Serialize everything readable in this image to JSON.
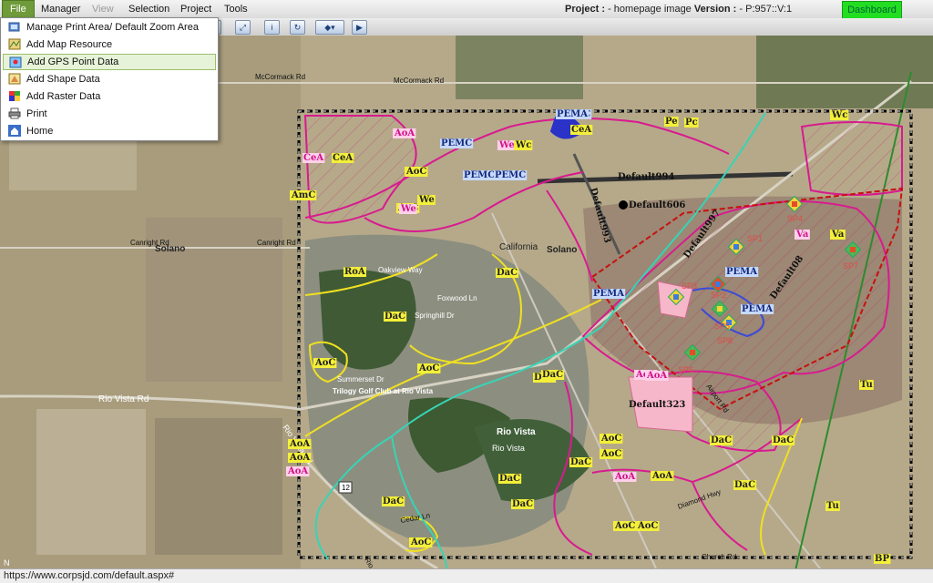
{
  "menu": {
    "items": [
      {
        "label": "File",
        "state": "active"
      },
      {
        "label": "Manager",
        "state": "normal"
      },
      {
        "label": "View",
        "state": "disabled"
      },
      {
        "label": "Selection",
        "state": "normal"
      },
      {
        "label": "Project",
        "state": "normal"
      },
      {
        "label": "Tools",
        "state": "normal"
      }
    ]
  },
  "project_info": {
    "project_label": "Project :",
    "project_value": "- homepage image",
    "version_label": "Version :",
    "version_value": "- P:957::V:1"
  },
  "dashboard_label": "Dashboard",
  "toolbar": {
    "buttons": [
      {
        "icon": "hand-pan-icon"
      },
      {
        "icon": "zoom-in-icon"
      },
      {
        "icon": "zoom-out-icon"
      },
      {
        "icon": "full-extent-icon"
      },
      {
        "icon": "identify-icon"
      },
      {
        "icon": "refresh-icon"
      },
      {
        "icon": "layers-icon"
      },
      {
        "icon": "next-icon"
      }
    ]
  },
  "file_menu": {
    "items": [
      {
        "label": "Manage Print Area/ Default Zoom Area",
        "icon": "print-area-icon"
      },
      {
        "label": "Add Map Resource",
        "icon": "map-resource-icon"
      },
      {
        "label": "Add GPS Point Data",
        "icon": "gps-point-icon",
        "highlighted": true
      },
      {
        "label": "Add Shape Data",
        "icon": "shape-data-icon"
      },
      {
        "label": "Add Raster Data",
        "icon": "raster-data-icon"
      },
      {
        "label": "Print",
        "icon": "printer-icon"
      },
      {
        "label": "Home",
        "icon": "home-icon"
      }
    ]
  },
  "map_labels": {
    "roads": [
      "McCormack Rd",
      "McCormack Rd",
      "Canright Rd",
      "Canright Rd",
      "Rio Vista Rd",
      "Rio Vista Rd",
      "Airport Rd",
      "Rio Vista",
      "Diamond Hwy",
      "Cedar Ln",
      "Rio Vista Rd",
      "Foxwood Ln",
      "Springhill Dr",
      "Summerset Dr",
      "Oakview Way",
      "Church Rd"
    ],
    "places": [
      "Solano",
      "Solano",
      "California",
      "Rio Vista",
      "Trilogy Golf Club at Rio Vista"
    ],
    "shield": "12",
    "soil": [
      "CeA",
      "CeA",
      "AoA",
      "AoC",
      "AoC",
      "We",
      "We",
      "We",
      "Wc",
      "Wc",
      "AmC",
      "PEMC",
      "PEMC",
      "PEMC",
      "PEMC",
      "PEMA",
      "PEMA",
      "PEMA",
      "PEMA",
      "Pe",
      "Pc",
      "CeA",
      "RoA",
      "DaC",
      "DaC",
      "AoC",
      "AoC",
      "DaC",
      "DaC",
      "AoA",
      "AoA",
      "AoA",
      "AoA",
      "AoC",
      "AoC",
      "DaC",
      "DaC",
      "DaC",
      "DaC",
      "AoC",
      "AoC",
      "DaC",
      "AoA",
      "AoA",
      "AoC",
      "Va",
      "Va",
      "Tu",
      "Tu",
      "DaC",
      "DaC",
      "BP",
      "AoA",
      "AoC"
    ],
    "defaults": [
      "Default994",
      "Default993",
      "Default606",
      "Default997",
      "Default08",
      "Default323"
    ],
    "sample_points": [
      "SP1",
      "SP2",
      "SP3",
      "SP4",
      "SP5",
      "SP6",
      "SP7",
      "SP8"
    ],
    "compass": "N"
  },
  "status_url": "https://www.corpsjd.com/default.aspx#"
}
